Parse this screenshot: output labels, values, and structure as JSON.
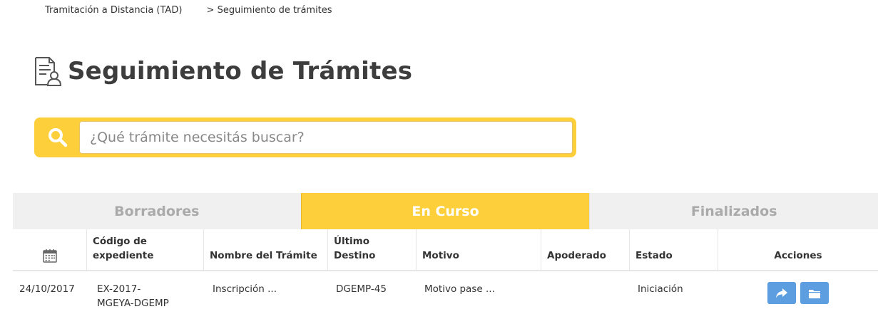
{
  "breadcrumb": {
    "root": "Tramitación a Distancia (TAD)",
    "current": "> Seguimiento de trámites"
  },
  "page": {
    "title": "Seguimiento de Trámites"
  },
  "search": {
    "placeholder": "¿Qué trámite necesitás buscar?",
    "value": ""
  },
  "tabs": [
    {
      "label": "Borradores",
      "active": false
    },
    {
      "label": "En Curso",
      "active": true
    },
    {
      "label": "Finalizados",
      "active": false
    }
  ],
  "table": {
    "date_column_icon": "calendar-icon",
    "headers": [
      "Código de expediente",
      "Nombre del Trámite",
      "Último Destino",
      "Motivo",
      "Apoderado",
      "Estado",
      "Acciones"
    ],
    "rows": [
      {
        "fecha": "24/10/2017",
        "codigo": "EX-2017-\nMGEYA-DGEMP",
        "nombre": "Inscripción ...",
        "destino": "DGEMP-45",
        "motivo": "Motivo pase ...",
        "apoderado": "",
        "estado": "Iniciación",
        "actions": [
          "share-icon",
          "folder-icon"
        ]
      }
    ]
  },
  "colors": {
    "accent": "#fdd03b",
    "button": "#5c9ee0",
    "title": "#3d3d3d",
    "tab_inactive_bg": "#f0f0f0",
    "tab_inactive_text": "#aaaaaa"
  }
}
